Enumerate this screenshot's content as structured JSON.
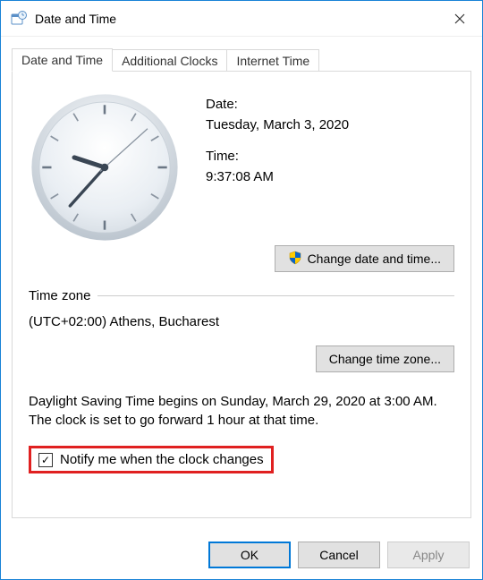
{
  "window": {
    "title": "Date and Time"
  },
  "tabs": [
    {
      "label": "Date and Time"
    },
    {
      "label": "Additional Clocks"
    },
    {
      "label": "Internet Time"
    }
  ],
  "datetime": {
    "date_label": "Date:",
    "date_value": "Tuesday, March 3, 2020",
    "time_label": "Time:",
    "time_value": "9:37:08 AM",
    "change_button": "Change date and time..."
  },
  "timezone": {
    "section_label": "Time zone",
    "value": "(UTC+02:00) Athens, Bucharest",
    "change_button": "Change time zone..."
  },
  "dst": {
    "text": "Daylight Saving Time begins on Sunday, March 29, 2020 at 3:00 AM. The clock is set to go forward 1 hour at that time.",
    "notify_checked": true,
    "notify_label": "Notify me when the clock changes"
  },
  "buttons": {
    "ok": "OK",
    "cancel": "Cancel",
    "apply": "Apply"
  },
  "clock": {
    "hour_hand_deg": 288,
    "minute_hand_deg": 222,
    "second_hand_deg": 48
  }
}
